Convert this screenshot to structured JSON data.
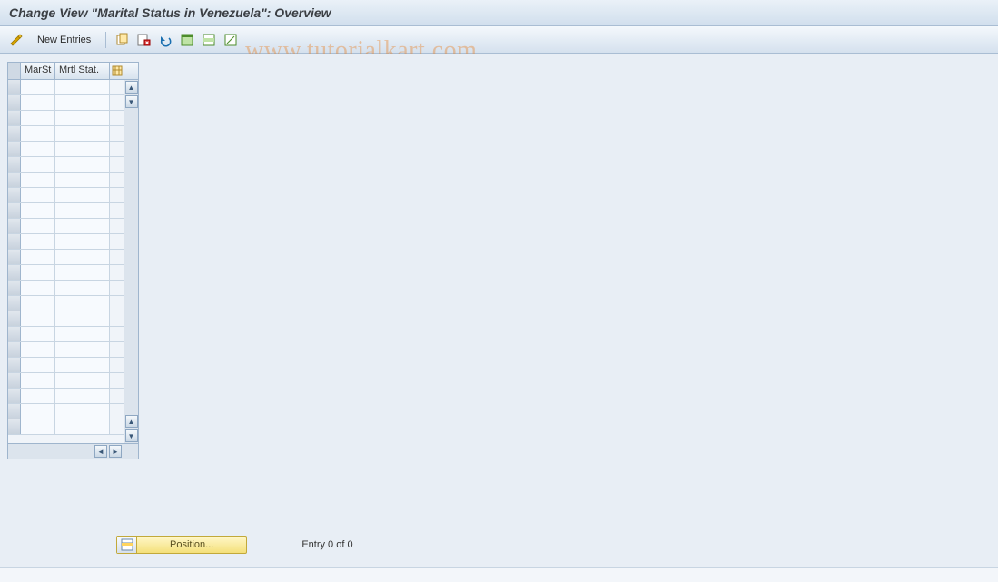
{
  "title": "Change View \"Marital Status in Venezuela\": Overview",
  "toolbar": {
    "new_entries": "New Entries",
    "icons": {
      "toggle": "display-change-icon",
      "copy": "copy-icon",
      "delete": "delete-icon",
      "undo": "undo-icon",
      "select_all": "select-all-icon",
      "select_block": "select-block-icon",
      "deselect": "deselect-all-icon"
    }
  },
  "table": {
    "columns": [
      "MarSt",
      "Mrtl Stat."
    ],
    "config_icon": "table-settings-icon",
    "rows": [
      {
        "marst": "",
        "mrtl_stat": ""
      },
      {
        "marst": "",
        "mrtl_stat": ""
      },
      {
        "marst": "",
        "mrtl_stat": ""
      },
      {
        "marst": "",
        "mrtl_stat": ""
      },
      {
        "marst": "",
        "mrtl_stat": ""
      },
      {
        "marst": "",
        "mrtl_stat": ""
      },
      {
        "marst": "",
        "mrtl_stat": ""
      },
      {
        "marst": "",
        "mrtl_stat": ""
      },
      {
        "marst": "",
        "mrtl_stat": ""
      },
      {
        "marst": "",
        "mrtl_stat": ""
      },
      {
        "marst": "",
        "mrtl_stat": ""
      },
      {
        "marst": "",
        "mrtl_stat": ""
      },
      {
        "marst": "",
        "mrtl_stat": ""
      },
      {
        "marst": "",
        "mrtl_stat": ""
      },
      {
        "marst": "",
        "mrtl_stat": ""
      },
      {
        "marst": "",
        "mrtl_stat": ""
      },
      {
        "marst": "",
        "mrtl_stat": ""
      },
      {
        "marst": "",
        "mrtl_stat": ""
      },
      {
        "marst": "",
        "mrtl_stat": ""
      },
      {
        "marst": "",
        "mrtl_stat": ""
      },
      {
        "marst": "",
        "mrtl_stat": ""
      },
      {
        "marst": "",
        "mrtl_stat": ""
      },
      {
        "marst": "",
        "mrtl_stat": ""
      }
    ]
  },
  "footer": {
    "position_label": "Position...",
    "entry_text": "Entry 0 of 0"
  },
  "watermark": "www.tutorialkart.com"
}
